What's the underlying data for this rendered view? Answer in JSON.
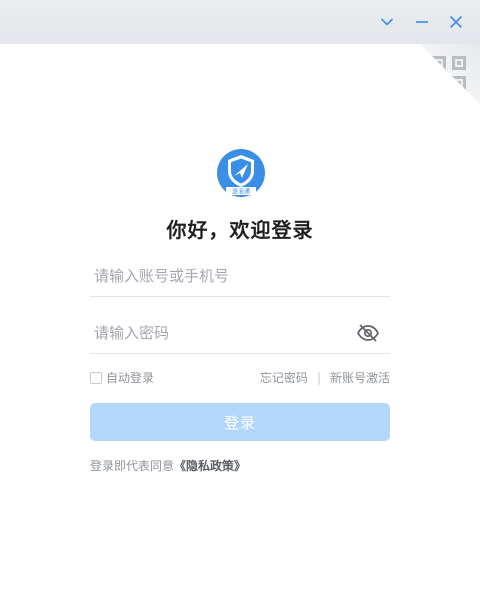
{
  "window": {
    "controls": [
      "chevron-down-icon",
      "minimize-icon",
      "close-icon"
    ],
    "accent_color": "#3a8ee6"
  },
  "logo": {
    "caption": "逐浪通",
    "color": "#3a8ee6"
  },
  "headline": "你好，欢迎登录",
  "form": {
    "account_placeholder": "请输入账号或手机号",
    "password_placeholder": "请输入密码",
    "auto_login_label": "自动登录",
    "forgot_password": "忘记密码",
    "separator": "|",
    "activate_account": "新账号激活",
    "login_button": "登录",
    "login_button_color": "#b3d7fb"
  },
  "agreement": {
    "prefix": "登录即代表同意",
    "policy_link": "《隐私政策》"
  }
}
